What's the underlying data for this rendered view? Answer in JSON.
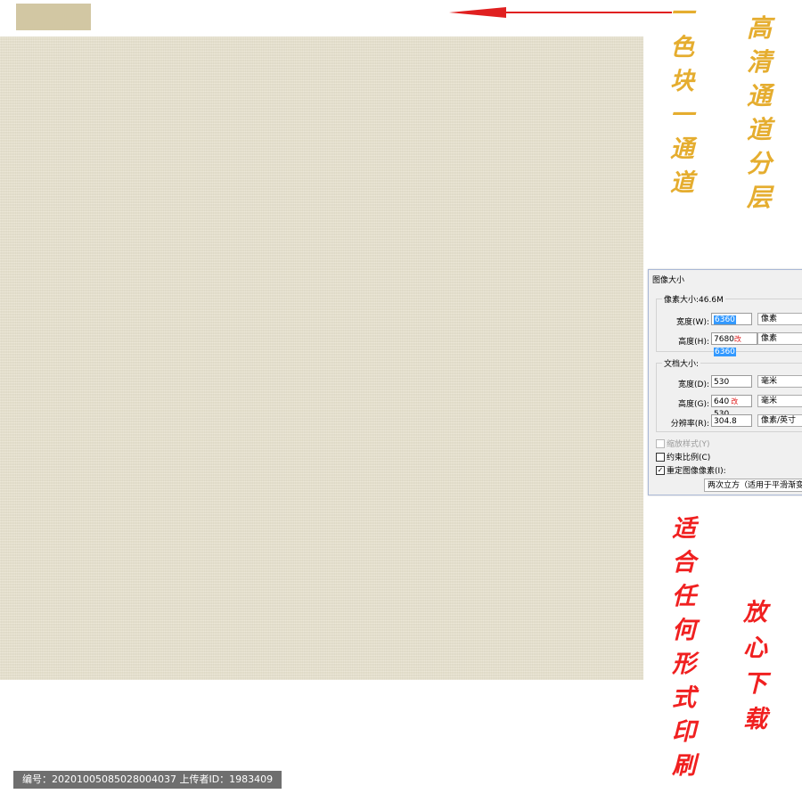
{
  "annotations": {
    "left_column": [
      "一",
      "色",
      "块",
      "一",
      "通",
      "道"
    ],
    "right_column": [
      "高",
      "清",
      "通",
      "道",
      "分",
      "层"
    ],
    "bottom_left_column": [
      "适",
      "合",
      "任",
      "何",
      "形",
      "式",
      "印",
      "刷"
    ],
    "bottom_right_column": [
      "放",
      "心",
      "下",
      "载"
    ]
  },
  "colors": {
    "swatch": "#d2c7a3",
    "texture": "#e8e2cf",
    "gold_text": "#e5ad2f",
    "red_text": "#f02020",
    "arrow": "#e02020"
  },
  "dialog": {
    "title": "图像大小",
    "pixel_group_title": "像素大小:46.6M",
    "width_label": "宽度(W):",
    "width_value": "6360",
    "height_label": "高度(H):",
    "height_value_original": "7680",
    "height_value_new": "6360",
    "change_mark": "改",
    "pixel_unit_1": "像素",
    "pixel_unit_2": "像素",
    "doc_group_title": "文档大小:",
    "doc_width_label": "宽度(D):",
    "doc_width_value": "530",
    "doc_width_unit": "毫米",
    "doc_height_label": "高度(G):",
    "doc_height_value_original": "640",
    "doc_height_value_new": "530",
    "doc_height_unit": "毫米",
    "resolution_label": "分辨率(R):",
    "resolution_value": "304.8",
    "resolution_unit": "像素/英寸",
    "scale_styles_label": "缩放样式(Y)",
    "constrain_label": "约束比例(C)",
    "resample_label": "重定图像像素(I):",
    "resample_value": "两次立方（适用于平滑渐变）"
  },
  "footer": {
    "text": "编号：20201005085028004037 上传者ID：1983409"
  }
}
